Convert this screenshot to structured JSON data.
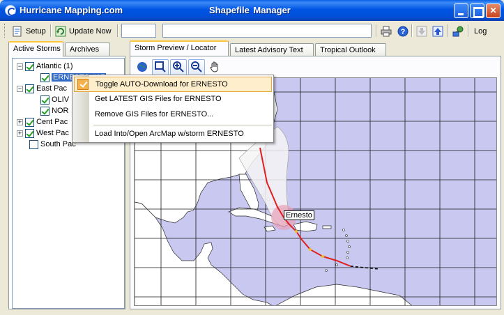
{
  "window": {
    "app_title": "Hurricane Mapping.com",
    "title": "Shapefile  Manager",
    "minimize_label": "",
    "maximize_label": "",
    "close_label": "✕"
  },
  "toolbar": {
    "setup_label": "Setup",
    "update_label": "Update Now",
    "small_field_value": "",
    "status_field_value": "",
    "log_label": "Log",
    "icons": [
      "setup-icon",
      "refresh-icon",
      "print-icon",
      "help-icon",
      "download-icon",
      "upload-icon",
      "globe-network-icon"
    ]
  },
  "left_tabs": [
    {
      "label": "Active Storms",
      "active": true
    },
    {
      "label": "Archives",
      "active": false
    }
  ],
  "tree": {
    "atlantic_label": "Atlantic (1)",
    "ernesto_label": "ERNESTO #17",
    "eastpac_label": "East Pac",
    "olivia_label": "OLIV",
    "norman_label": "NOR",
    "centpac_label": "Cent Pac",
    "westpac_label": "West Pac",
    "southpac_label": "South Pac"
  },
  "right_tabs": [
    {
      "label": "Storm Preview / Locator",
      "active": true
    },
    {
      "label": "Latest Advisory Text",
      "active": false
    },
    {
      "label": "Tropical Outlook",
      "active": false
    }
  ],
  "map_tools": [
    "globe-icon",
    "zoom-box-icon",
    "zoom-in-icon",
    "zoom-out-icon",
    "pan-hand-icon"
  ],
  "context_menu": {
    "toggle_label": "Toggle AUTO-Download for ERNESTO",
    "get_latest_label": "Get LATEST GIS Files for ERNESTO",
    "remove_label": "Remove GIS Files for ERNESTO...",
    "load_label": "Load Into/Open ArcMap w/storm ERNESTO"
  },
  "map": {
    "storm_label": "Ernesto",
    "ocean_color": "#c8c8f0",
    "land_color": "#ffffff",
    "cone_color": "#f0f0f0",
    "track_color": "#e02020"
  }
}
